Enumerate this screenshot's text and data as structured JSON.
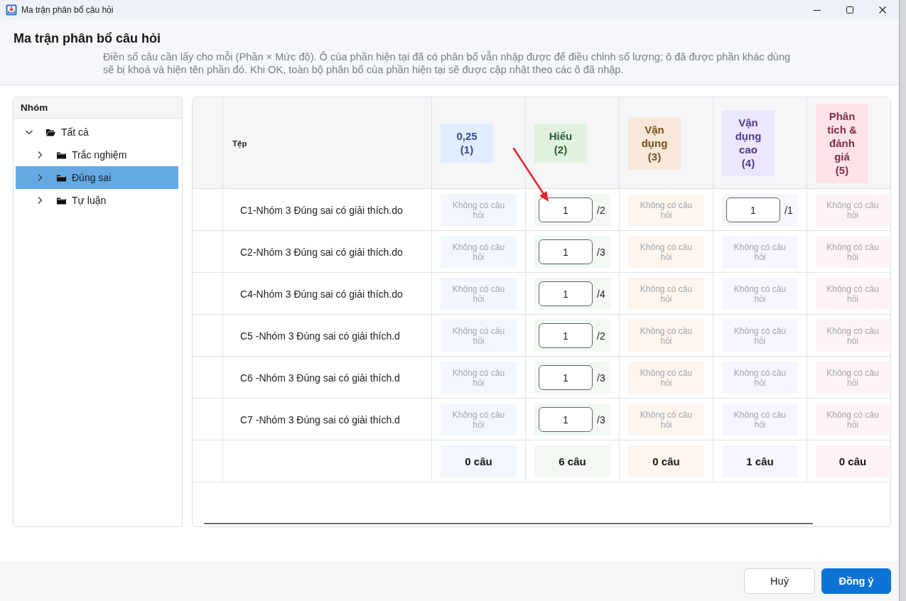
{
  "window": {
    "title": "Ma trận phân bổ câu hỏi"
  },
  "header": {
    "title": "Ma trận phân bổ câu hỏi",
    "description": "Điền số câu cần lấy cho mỗi (Phần × Mức độ). Ô của phần hiện tại đã có phân bổ vẫn nhập được để điều chỉnh số lượng; ô đã được phần khác dùng sẽ bị khoá và hiện tên phần đó. Khi OK, toàn bộ phân bổ của phần hiện tại sẽ được cập nhật theo các ô đã nhập."
  },
  "sidebar": {
    "title": "Nhóm",
    "tree": [
      {
        "label": "Tất cả",
        "expanded": true,
        "selected": false,
        "children": [
          {
            "label": "Trắc nghiệm",
            "expanded": false,
            "selected": false
          },
          {
            "label": "Đúng sai",
            "expanded": false,
            "selected": true
          },
          {
            "label": "Tự luận",
            "expanded": false,
            "selected": false
          }
        ]
      }
    ]
  },
  "table": {
    "file_header": "Tệp",
    "levels": [
      {
        "label": "0,25",
        "index": "(1)",
        "color": "#33508c"
      },
      {
        "label": "Hiểu",
        "index": "(2)",
        "color": "#2b5e2f"
      },
      {
        "label": "Vận dụng",
        "index": "(3)",
        "color": "#7a4e1c"
      },
      {
        "label": "Vận dụng cao",
        "index": "(4)",
        "color": "#52388a"
      },
      {
        "label": "Phân tích & đánh giá",
        "index": "(5)",
        "color": "#7e3048"
      }
    ],
    "rows": [
      {
        "file": "C1-Nhóm 3 Đúng sai có giải thích.do",
        "cells": [
          {
            "kind": "empty",
            "text": "Không có câu hỏi"
          },
          {
            "kind": "input",
            "value": "1",
            "available": "/2"
          },
          {
            "kind": "empty",
            "text": "Không có câu hỏi"
          },
          {
            "kind": "input",
            "value": "1",
            "available": "/1"
          },
          {
            "kind": "empty",
            "text": "Không có câu hỏi"
          }
        ]
      },
      {
        "file": "C2-Nhóm 3 Đúng sai có giải thích.do",
        "cells": [
          {
            "kind": "empty",
            "text": "Không có câu hỏi"
          },
          {
            "kind": "input",
            "value": "1",
            "available": "/3"
          },
          {
            "kind": "empty",
            "text": "Không có câu hỏi"
          },
          {
            "kind": "empty",
            "text": "Không có câu hỏi"
          },
          {
            "kind": "empty",
            "text": "Không có câu hỏi"
          }
        ]
      },
      {
        "file": "C4-Nhóm 3 Đúng sai có giải thích.do",
        "cells": [
          {
            "kind": "empty",
            "text": "Không có câu hỏi"
          },
          {
            "kind": "input",
            "value": "1",
            "available": "/4"
          },
          {
            "kind": "empty",
            "text": "Không có câu hỏi"
          },
          {
            "kind": "empty",
            "text": "Không có câu hỏi"
          },
          {
            "kind": "empty",
            "text": "Không có câu hỏi"
          }
        ]
      },
      {
        "file": "C5 -Nhóm 3 Đúng sai có giải thích.d",
        "cells": [
          {
            "kind": "empty",
            "text": "Không có câu hỏi"
          },
          {
            "kind": "input",
            "value": "1",
            "available": "/2"
          },
          {
            "kind": "empty",
            "text": "Không có câu hỏi"
          },
          {
            "kind": "empty",
            "text": "Không có câu hỏi"
          },
          {
            "kind": "empty",
            "text": "Không có câu hỏi"
          }
        ]
      },
      {
        "file": "C6 -Nhóm 3 Đúng sai có giải thích.d",
        "cells": [
          {
            "kind": "empty",
            "text": "Không có câu hỏi"
          },
          {
            "kind": "input",
            "value": "1",
            "available": "/3"
          },
          {
            "kind": "empty",
            "text": "Không có câu hỏi"
          },
          {
            "kind": "empty",
            "text": "Không có câu hỏi"
          },
          {
            "kind": "empty",
            "text": "Không có câu hỏi"
          }
        ]
      },
      {
        "file": "C7 -Nhóm 3 Đúng sai có giải thích.d",
        "cells": [
          {
            "kind": "empty",
            "text": "Không có câu hỏi"
          },
          {
            "kind": "input",
            "value": "1",
            "available": "/3"
          },
          {
            "kind": "empty",
            "text": "Không có câu hỏi"
          },
          {
            "kind": "empty",
            "text": "Không có câu hỏi"
          },
          {
            "kind": "empty",
            "text": "Không có câu hỏi"
          }
        ]
      }
    ],
    "totals": [
      "0 câu",
      "6 câu",
      "0 câu",
      "1 câu",
      "0 câu"
    ]
  },
  "buttons": [
    {
      "label": "Huỷ",
      "kind": "secondary"
    },
    {
      "label": "Đồng ý",
      "kind": "primary"
    }
  ]
}
